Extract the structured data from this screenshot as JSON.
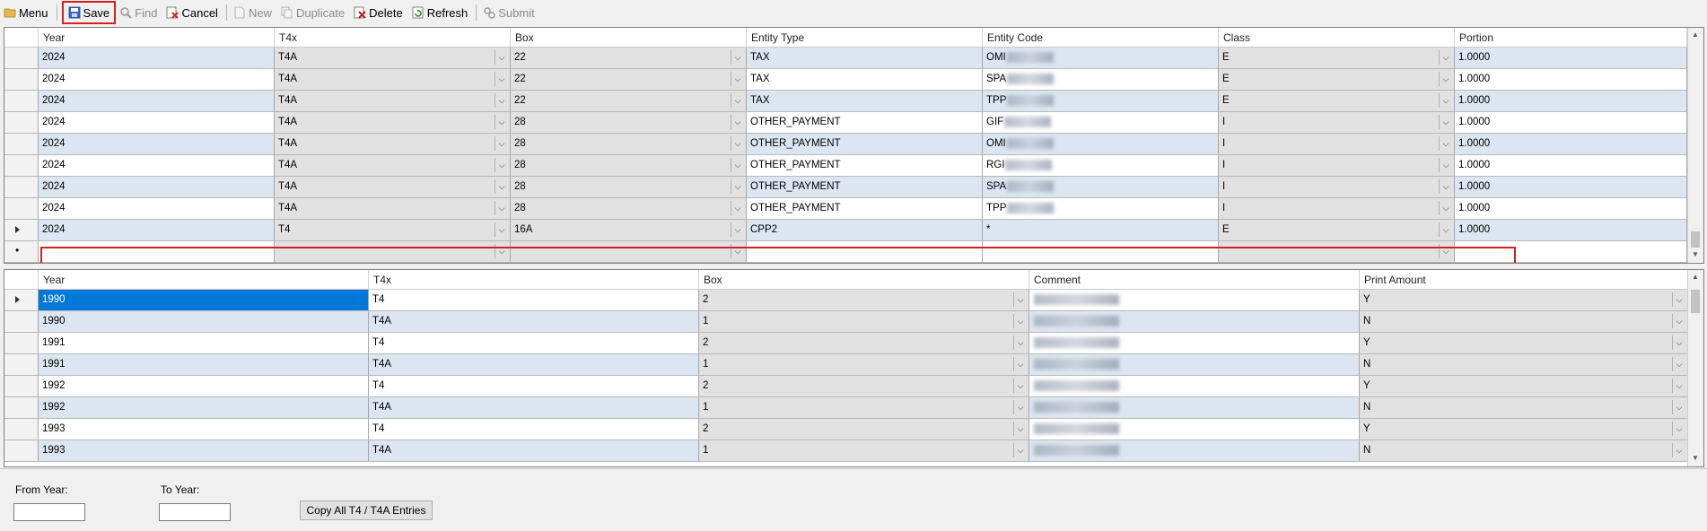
{
  "toolbar": {
    "menu": "Menu",
    "save": "Save",
    "find": "Find",
    "cancel": "Cancel",
    "new": "New",
    "duplicate": "Duplicate",
    "delete": "Delete",
    "refresh": "Refresh",
    "submit": "Submit"
  },
  "top_grid": {
    "headers": [
      "Year",
      "T4x",
      "Box",
      "Entity Type",
      "Entity Code",
      "Class",
      "Portion"
    ],
    "rows": [
      {
        "year": "2024",
        "t4x": "T4A",
        "box": "22",
        "entity_type": "TAX",
        "entity_code": "OMI",
        "class": "E",
        "portion": "1.0000"
      },
      {
        "year": "2024",
        "t4x": "T4A",
        "box": "22",
        "entity_type": "TAX",
        "entity_code": "SPA",
        "class": "E",
        "portion": "1.0000"
      },
      {
        "year": "2024",
        "t4x": "T4A",
        "box": "22",
        "entity_type": "TAX",
        "entity_code": "TPP",
        "class": "E",
        "portion": "1.0000"
      },
      {
        "year": "2024",
        "t4x": "T4A",
        "box": "28",
        "entity_type": "OTHER_PAYMENT",
        "entity_code": "GIF",
        "class": "I",
        "portion": "1.0000"
      },
      {
        "year": "2024",
        "t4x": "T4A",
        "box": "28",
        "entity_type": "OTHER_PAYMENT",
        "entity_code": "OMI",
        "class": "I",
        "portion": "1.0000"
      },
      {
        "year": "2024",
        "t4x": "T4A",
        "box": "28",
        "entity_type": "OTHER_PAYMENT",
        "entity_code": "RGI",
        "class": "I",
        "portion": "1.0000"
      },
      {
        "year": "2024",
        "t4x": "T4A",
        "box": "28",
        "entity_type": "OTHER_PAYMENT",
        "entity_code": "SPA",
        "class": "I",
        "portion": "1.0000"
      },
      {
        "year": "2024",
        "t4x": "T4A",
        "box": "28",
        "entity_type": "OTHER_PAYMENT",
        "entity_code": "TPP",
        "class": "I",
        "portion": "1.0000"
      },
      {
        "year": "2024",
        "t4x": "T4",
        "box": "16A",
        "entity_type": "CPP2",
        "entity_code": "*",
        "class": "E",
        "portion": "1.0000"
      }
    ]
  },
  "bottom_grid": {
    "headers": [
      "Year",
      "T4x",
      "Box",
      "Comment",
      "Print Amount"
    ],
    "rows": [
      {
        "year": "1990",
        "t4x": "T4",
        "box": "2",
        "print_amount": "Y"
      },
      {
        "year": "1990",
        "t4x": "T4A",
        "box": "1",
        "print_amount": "N"
      },
      {
        "year": "1991",
        "t4x": "T4",
        "box": "2",
        "print_amount": "Y"
      },
      {
        "year": "1991",
        "t4x": "T4A",
        "box": "1",
        "print_amount": "N"
      },
      {
        "year": "1992",
        "t4x": "T4",
        "box": "2",
        "print_amount": "Y"
      },
      {
        "year": "1992",
        "t4x": "T4A",
        "box": "1",
        "print_amount": "N"
      },
      {
        "year": "1993",
        "t4x": "T4",
        "box": "2",
        "print_amount": "Y"
      },
      {
        "year": "1993",
        "t4x": "T4A",
        "box": "1",
        "print_amount": "N"
      }
    ]
  },
  "copy_panel": {
    "from_year_label": "From Year:",
    "to_year_label": "To Year:",
    "from_year_value": "",
    "to_year_value": "",
    "copy_button": "Copy All T4 / T4A Entries"
  },
  "colors": {
    "highlight": "#d62020",
    "row_alt": "#dce6f2",
    "selected": "#0078d7"
  }
}
